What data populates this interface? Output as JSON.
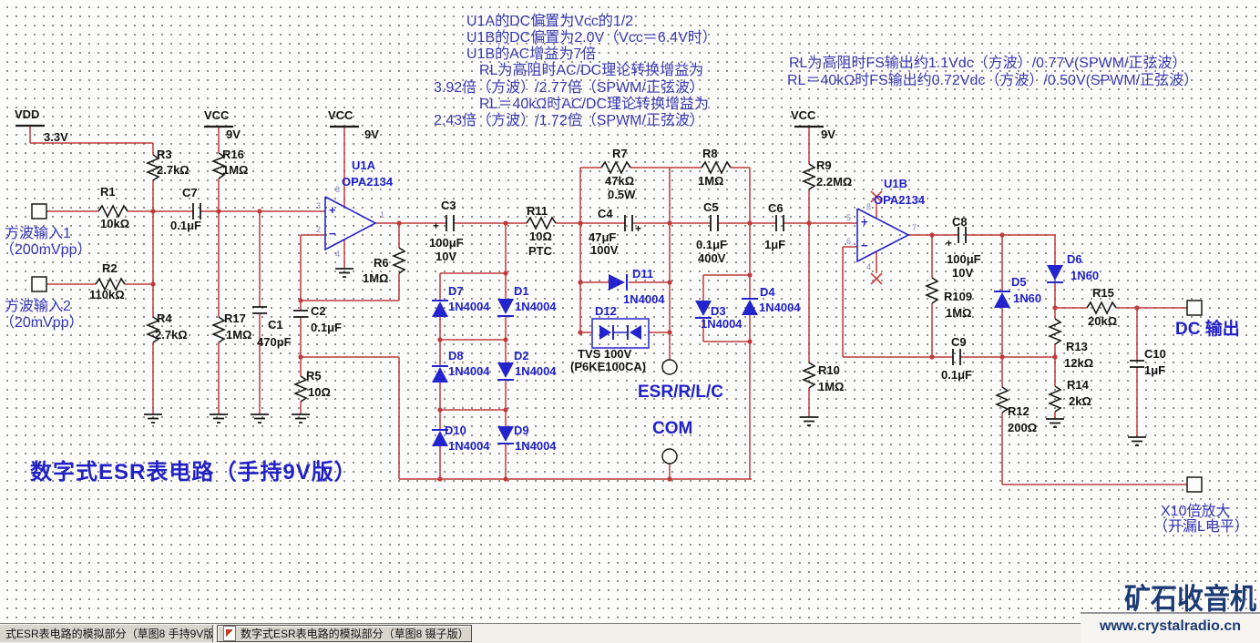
{
  "title": {
    "text": "数字式ESR表电路（手持9V版）"
  },
  "colors": {
    "wire_red": "#bf3a3a",
    "symbol_blue": "#2424cc",
    "label_blue": "#2121c8",
    "annotation_blue": "#3a3ab2",
    "title_blue": "#2222c4",
    "logo_navy": "#1c3a74"
  },
  "texts": {
    "annotations": [
      [
        "U1A的DC偏置为Vcc的1/2",
        512,
        15,
        "a"
      ],
      [
        "U1B的DC偏置为2.0V（Vcc＝6.4V时）",
        512,
        33,
        "a"
      ],
      [
        "U1B的AC增益为7倍",
        512,
        51,
        "a"
      ],
      [
        "RL为高阻时AC/DC理论转换增益为",
        526,
        69,
        "a"
      ],
      [
        "3.92倍（方波）/2.77倍（SPWM/正弦波）",
        476,
        88,
        "a"
      ],
      [
        "RL＝40kΩ时AC/DC理论转换增益为",
        526,
        106,
        "a"
      ],
      [
        "2.43倍（方波）/1.72倍（SPWM/正弦波）",
        476,
        124,
        "a"
      ],
      [
        "RL为高阻时FS输出约1.1Vdc（方波）/0.77V(SPWM/正弦波）",
        866,
        61,
        "a"
      ],
      [
        "RL＝40kΩ时FS输出约0.72Vdc（方波）/0.50V(SPWM/正弦波）",
        864,
        80,
        "a"
      ]
    ],
    "netnames": [
      [
        "VDD",
        16,
        119,
        "k"
      ],
      [
        "3.3V",
        48,
        144,
        "k"
      ],
      [
        "VCC",
        224,
        120,
        "k"
      ],
      [
        "9V",
        248,
        141,
        "k"
      ],
      [
        "VCC",
        360,
        120,
        "k"
      ],
      [
        "9V",
        400,
        141,
        "k"
      ],
      [
        "VCC",
        868,
        120,
        "k"
      ],
      [
        "9V",
        901,
        141,
        "k"
      ]
    ],
    "parts": [
      [
        "R3",
        172,
        163,
        "k"
      ],
      [
        "2.7kΩ",
        172,
        180,
        "k"
      ],
      [
        "R16",
        244,
        163,
        "k"
      ],
      [
        "1MΩ",
        244,
        180,
        "k"
      ],
      [
        "R1",
        110,
        204,
        "k"
      ],
      [
        "10kΩ",
        110,
        239,
        "k"
      ],
      [
        "C7",
        200,
        205,
        "k"
      ],
      [
        "0.1μF",
        187,
        241,
        "k"
      ],
      [
        "R2",
        112,
        288,
        "k"
      ],
      [
        "110kΩ",
        98,
        317,
        "k"
      ],
      [
        "R4",
        172,
        343,
        "k"
      ],
      [
        "2.7kΩ",
        170,
        361,
        "k"
      ],
      [
        "R17",
        246,
        343,
        "k"
      ],
      [
        "1MΩ",
        248,
        361,
        "k"
      ],
      [
        "C1",
        294,
        350,
        "k"
      ],
      [
        "470pF",
        282,
        369,
        "k"
      ],
      [
        "C2",
        341,
        335,
        "k"
      ],
      [
        "0.1μF",
        341,
        353,
        "k"
      ],
      [
        "R5",
        336,
        406,
        "k"
      ],
      [
        "10Ω",
        338,
        424,
        "k"
      ],
      [
        "R6",
        410,
        282,
        "k"
      ],
      [
        "1MΩ",
        398,
        299,
        "k"
      ],
      [
        "C3",
        484,
        219,
        "k"
      ],
      [
        "100μF",
        471,
        260,
        "k"
      ],
      [
        "10V",
        478,
        275,
        "k"
      ],
      [
        "R11",
        578,
        225,
        "k"
      ],
      [
        "10Ω",
        581,
        253,
        "k"
      ],
      [
        "PTC",
        580,
        269,
        "k"
      ],
      [
        "R7",
        672,
        162,
        "k"
      ],
      [
        "47kΩ",
        664,
        192,
        "k"
      ],
      [
        "0.5W",
        667,
        207,
        "k"
      ],
      [
        "R8",
        771,
        162,
        "k"
      ],
      [
        "1MΩ",
        766,
        192,
        "k"
      ],
      [
        "C4",
        656,
        228,
        "k"
      ],
      [
        "47μF",
        646,
        254,
        "k"
      ],
      [
        "100V",
        648,
        268,
        "k"
      ],
      [
        "C5",
        772,
        221,
        "k"
      ],
      [
        "0.1μF",
        764,
        262,
        "k"
      ],
      [
        "400V",
        766,
        277,
        "k"
      ],
      [
        "C6",
        843,
        222,
        "k"
      ],
      [
        "1μF",
        839,
        262,
        "k"
      ],
      [
        "TVS 100V",
        634,
        382,
        "k"
      ],
      [
        "(P6KE100CA)",
        626,
        396,
        "k"
      ],
      [
        "R9",
        896,
        175,
        "k"
      ],
      [
        "2.2MΩ",
        896,
        193,
        "k"
      ],
      [
        "R10",
        898,
        400,
        "k"
      ],
      [
        "1MΩ",
        898,
        418,
        "k"
      ],
      [
        "C8",
        1045,
        237,
        "k"
      ],
      [
        "100μF",
        1039,
        278,
        "k"
      ],
      [
        "10V",
        1045,
        293,
        "k"
      ],
      [
        "R109",
        1036,
        319,
        "k"
      ],
      [
        "1MΩ",
        1038,
        337,
        "k"
      ],
      [
        "C9",
        1044,
        369,
        "k"
      ],
      [
        "0.1μF",
        1033,
        405,
        "k"
      ],
      [
        "R15",
        1199,
        315,
        "k"
      ],
      [
        "20kΩ",
        1194,
        346,
        "k"
      ],
      [
        "R13",
        1170,
        374,
        "k"
      ],
      [
        "12kΩ",
        1168,
        392,
        "k"
      ],
      [
        "R14",
        1171,
        416,
        "k"
      ],
      [
        "2kΩ",
        1173,
        434,
        "k"
      ],
      [
        "R12",
        1106,
        445,
        "k"
      ],
      [
        "200Ω",
        1106,
        463,
        "k"
      ],
      [
        "C10",
        1256,
        382,
        "k"
      ],
      [
        "1μF",
        1256,
        400,
        "k"
      ],
      [
        "U1A",
        386,
        175,
        "b"
      ],
      [
        "OPA2134",
        375,
        193,
        "b"
      ],
      [
        "U1B",
        970,
        195,
        "b"
      ],
      [
        "OPA2134",
        959,
        213,
        "b"
      ],
      [
        "D7",
        492,
        313,
        "b"
      ],
      [
        "1N4004",
        492,
        330,
        "b"
      ],
      [
        "D1",
        564,
        313,
        "b"
      ],
      [
        "1N4004",
        565,
        330,
        "b"
      ],
      [
        "D8",
        492,
        384,
        "b"
      ],
      [
        "1N4004",
        492,
        401,
        "b"
      ],
      [
        "D2",
        564,
        384,
        "b"
      ],
      [
        "1N4004",
        565,
        401,
        "b"
      ],
      [
        "D10",
        488,
        466,
        "b"
      ],
      [
        "1N4004",
        492,
        483,
        "b"
      ],
      [
        "D9",
        564,
        466,
        "b"
      ],
      [
        "1N4004",
        565,
        483,
        "b"
      ],
      [
        "D11",
        694,
        294,
        "b"
      ],
      [
        "1N4004",
        684,
        322,
        "b"
      ],
      [
        "D12",
        653,
        335,
        "b"
      ],
      [
        "D3",
        780,
        335,
        "b"
      ],
      [
        "1N4004",
        769,
        349,
        "b"
      ],
      [
        "D4",
        834,
        314,
        "b"
      ],
      [
        "1N4004",
        833,
        331,
        "b"
      ],
      [
        "D5",
        1110,
        303,
        "b"
      ],
      [
        "1N60",
        1112,
        321,
        "b"
      ],
      [
        "D6",
        1171,
        278,
        "b"
      ],
      [
        "1N60",
        1175,
        296,
        "b"
      ],
      [
        "+",
        475,
        242,
        "plus"
      ],
      [
        "+",
        697,
        245,
        "plus"
      ],
      [
        "+",
        1038,
        261,
        "plus"
      ]
    ],
    "terminals": [
      [
        "方波输入1",
        5,
        248,
        "in"
      ],
      [
        "（200mVpp）",
        0,
        266,
        "in"
      ],
      [
        "方波输入2",
        5,
        328,
        "in"
      ],
      [
        "（20mVpp）",
        0,
        346,
        "in"
      ],
      [
        "ESR/R/L/C",
        700,
        420,
        "bb"
      ],
      [
        "COM",
        716,
        460,
        "bb"
      ],
      [
        "DC 输出",
        1290,
        351,
        "bb"
      ],
      [
        "X10倍放大",
        1274,
        553,
        "x10"
      ],
      [
        "（开漏L电平）",
        1266,
        570,
        "x10"
      ]
    ],
    "pins": [
      [
        "3",
        347,
        221,
        "pin"
      ],
      [
        "2",
        347,
        247,
        "pin"
      ],
      [
        "1",
        417,
        231,
        "pin"
      ],
      [
        "8",
        368,
        203,
        "pin"
      ],
      [
        "4",
        368,
        274,
        "pin"
      ],
      [
        "5",
        929,
        234,
        "pin"
      ],
      [
        "6",
        929,
        260,
        "pin"
      ],
      [
        "7",
        1001,
        245,
        "pin"
      ],
      [
        "8",
        951,
        222,
        "pin"
      ],
      [
        "4",
        951,
        288,
        "pin"
      ],
      [
        "+",
        361,
        224,
        "op"
      ],
      [
        "−",
        361,
        250,
        "op"
      ],
      [
        "+",
        945,
        237,
        "op"
      ],
      [
        "−",
        945,
        263,
        "op"
      ]
    ],
    "title": [
      [
        "数字式ESR表电路（手持9V版）",
        33,
        505,
        "ttl"
      ]
    ]
  },
  "tabs": [
    {
      "label": "式ESR表电路的模拟部分（草图8 手持9V版）"
    },
    {
      "label": "数字式ESR表电路的模拟部分（草图8 镊子版）"
    }
  ],
  "logo": {
    "brand": "矿石收音机",
    "url": "www.crystalradio.cn"
  }
}
